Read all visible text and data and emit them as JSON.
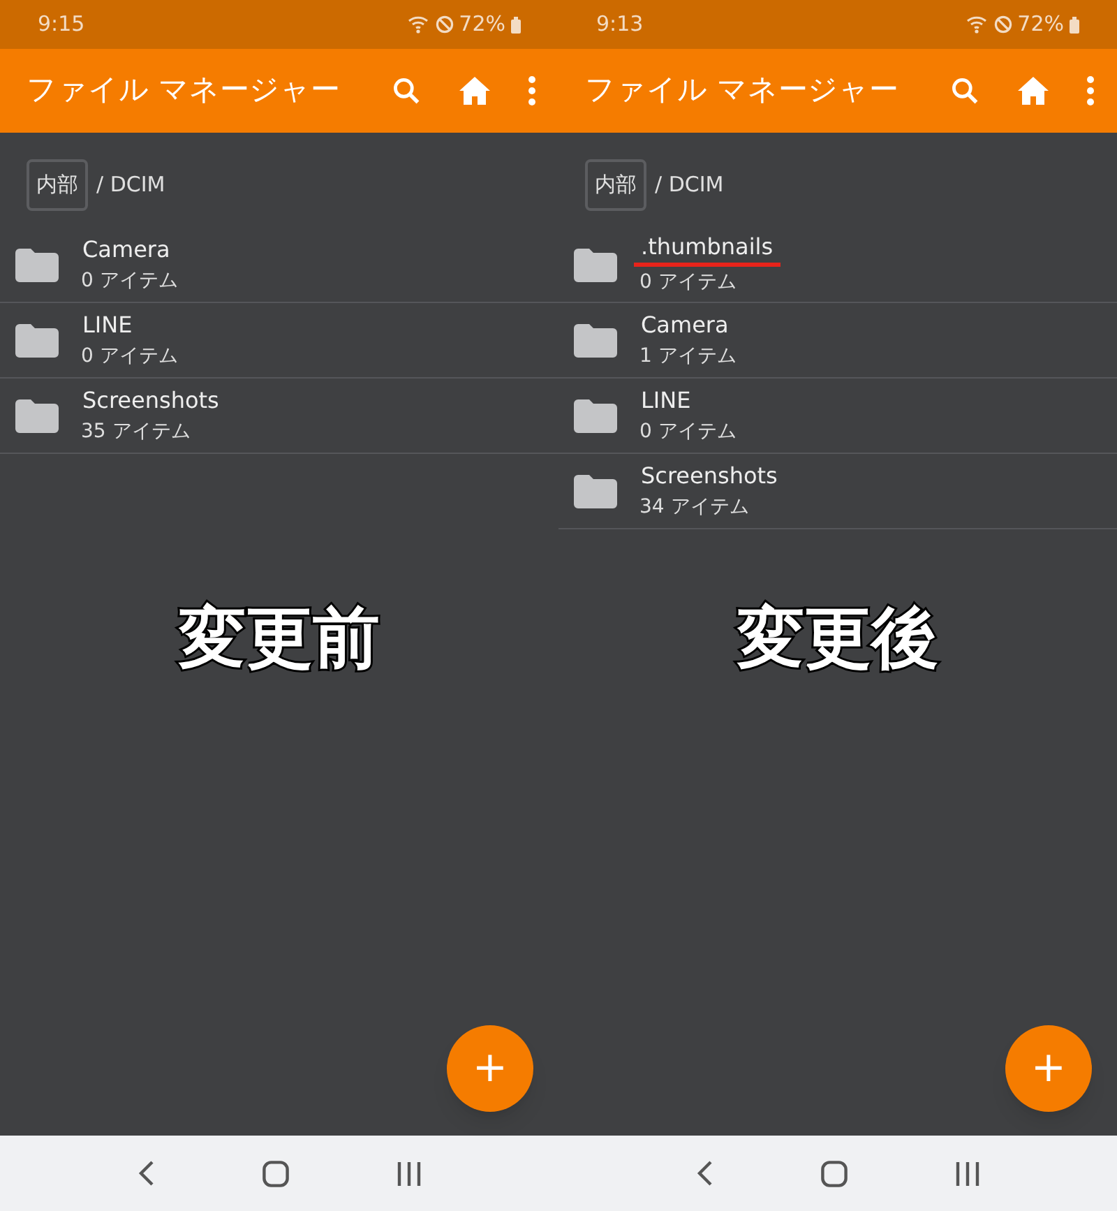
{
  "panels": [
    {
      "status_bar": {
        "time": "9:15",
        "battery": "72%"
      },
      "app_bar": {
        "title": "ファイル マネージャー"
      },
      "breadcrumb": {
        "root": "内部",
        "path": "/ DCIM"
      },
      "folders": [
        {
          "name": "Camera",
          "count": "0 アイテム",
          "highlighted": false
        },
        {
          "name": "LINE",
          "count": "0 アイテム",
          "highlighted": false
        },
        {
          "name": "Screenshots",
          "count": "35 アイテム",
          "highlighted": false
        }
      ],
      "caption": "変更前",
      "fab": "+"
    },
    {
      "status_bar": {
        "time": "9:13",
        "battery": "72%"
      },
      "app_bar": {
        "title": "ファイル マネージャー"
      },
      "breadcrumb": {
        "root": "内部",
        "path": "/ DCIM"
      },
      "folders": [
        {
          "name": ".thumbnails",
          "count": "0 アイテム",
          "highlighted": true
        },
        {
          "name": "Camera",
          "count": "1 アイテム",
          "highlighted": false
        },
        {
          "name": "LINE",
          "count": "0 アイテム",
          "highlighted": false
        },
        {
          "name": "Screenshots",
          "count": "34 アイテム",
          "highlighted": false
        }
      ],
      "caption": "変更後",
      "fab": "+"
    }
  ]
}
